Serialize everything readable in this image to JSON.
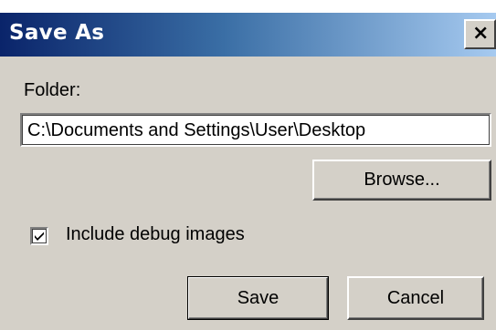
{
  "dialog": {
    "title": "Save As",
    "close_glyph": "×",
    "close_icon": "close-icon"
  },
  "folder": {
    "label": "Folder:",
    "value": "C:\\Documents and Settings\\User\\Desktop"
  },
  "browse_button": "Browse...",
  "debug_checkbox": {
    "label": "Include debug images",
    "checked": true
  },
  "actions": {
    "save": "Save",
    "cancel": "Cancel"
  },
  "colors": {
    "titlebar_start": "#0a246a",
    "titlebar_end": "#a6caf0",
    "window_bg": "#d4d0c8"
  }
}
